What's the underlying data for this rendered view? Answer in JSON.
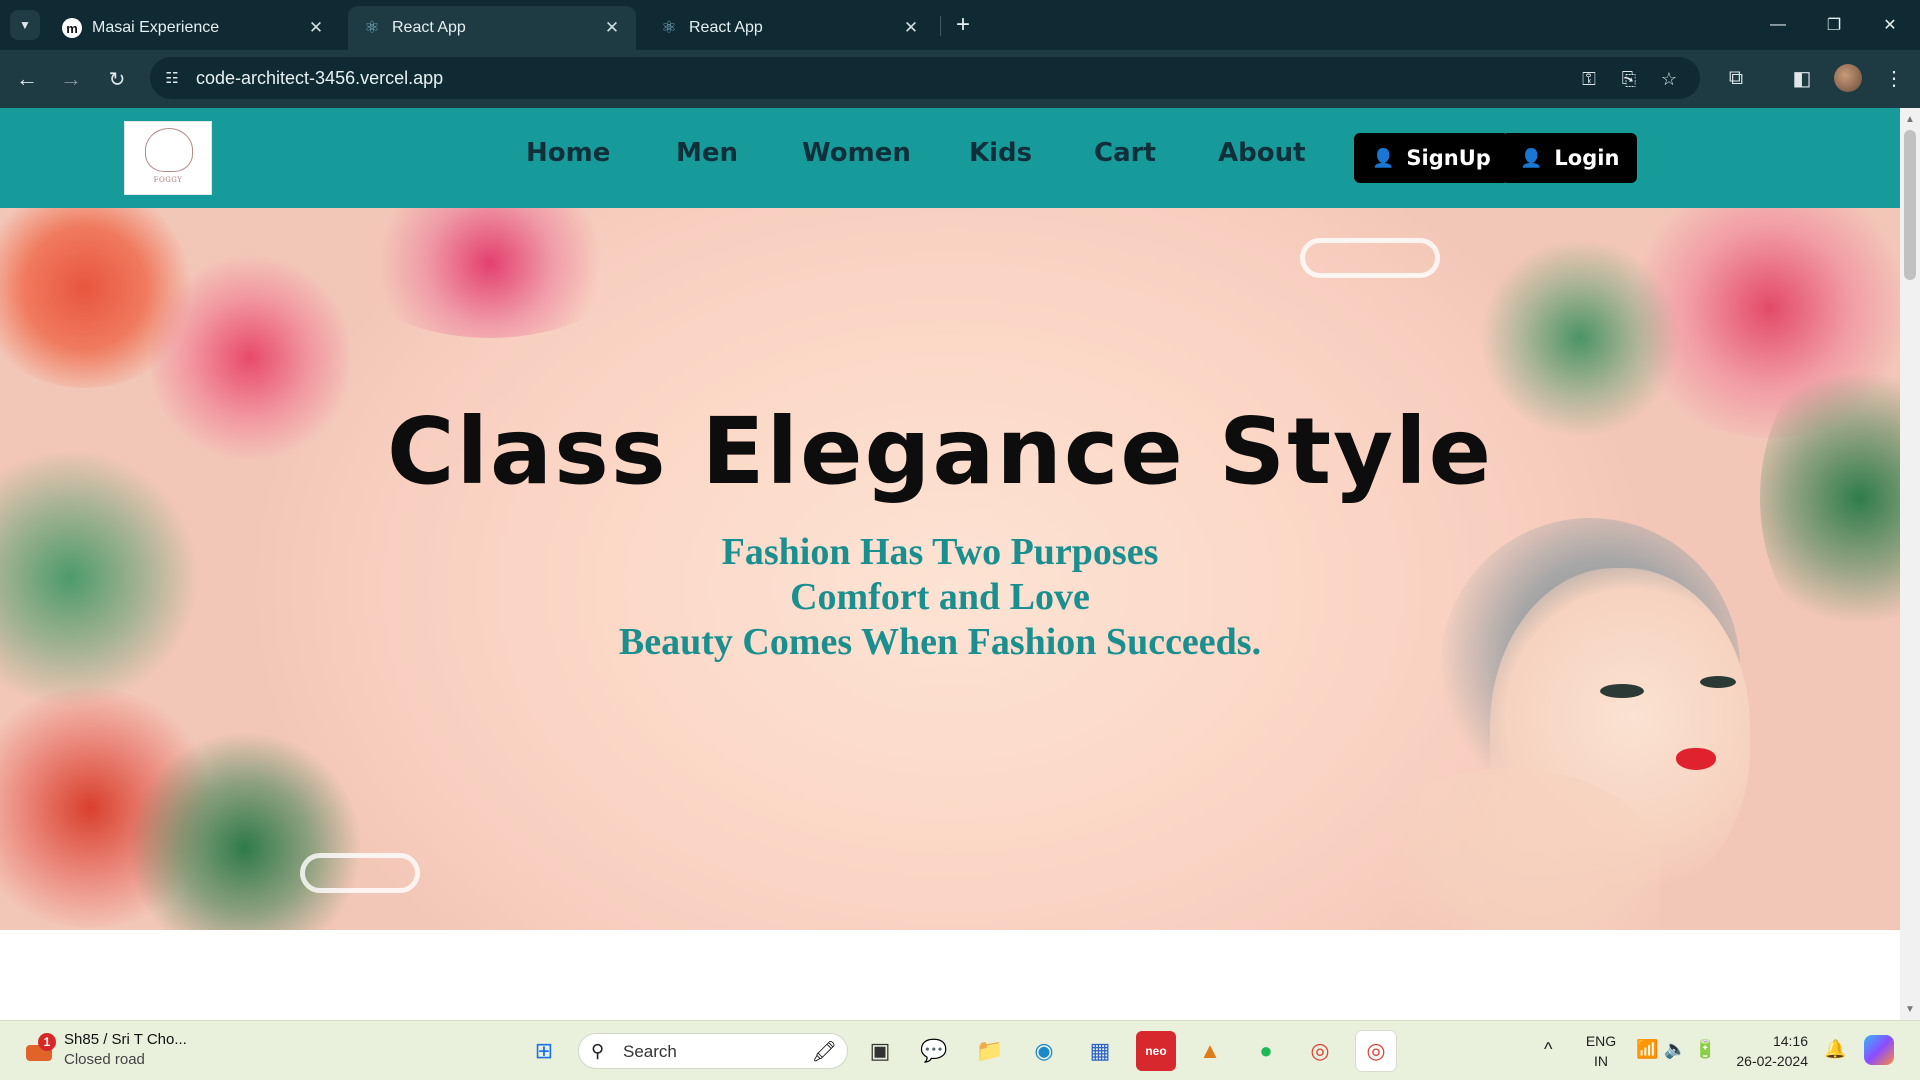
{
  "browser": {
    "tabs": [
      {
        "title": "Masai Experience",
        "active": false
      },
      {
        "title": "React App",
        "active": true
      },
      {
        "title": "React App",
        "active": false
      }
    ],
    "url": "code-architect-3456.vercel.app"
  },
  "site": {
    "nav": [
      "Home",
      "Men",
      "Women",
      "Kids",
      "Cart",
      "About"
    ],
    "signup_label": "SignUp",
    "login_label": "Login",
    "logo_text": "FOGGY"
  },
  "hero": {
    "title": "Class Elegance Style",
    "line1": "Fashion Has Two Purposes",
    "line2": "Comfort and Love",
    "line3": "Beauty Comes When Fashion Succeeds."
  },
  "taskbar": {
    "notification": {
      "title": "Sh85 / Sri T Cho...",
      "subtitle": "Closed road",
      "badge": "1"
    },
    "search_label": "Search",
    "language": {
      "line1": "ENG",
      "line2": "IN"
    },
    "time": "14:16",
    "date": "26-02-2024"
  },
  "colors": {
    "nav_bg": "#179a9a",
    "accent_text": "#1a8f8f"
  }
}
